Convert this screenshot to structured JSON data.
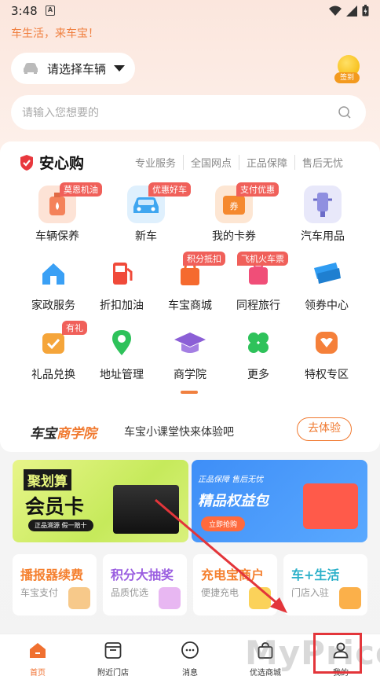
{
  "status_bar": {
    "time": "3:48",
    "app_badge": "A"
  },
  "header": {
    "slogan": "车生活，来车宝！",
    "car_selector": "请选择车辆",
    "signin_label": "签到",
    "search_placeholder": "请输入您想要的"
  },
  "anxin": {
    "brand": "安心购",
    "guarantees": [
      "专业服务",
      "全国网点",
      "正品保障",
      "售后无忧"
    ]
  },
  "services": [
    {
      "label": "车辆保养",
      "tag": "莫恩机油",
      "icon": "oil-bottle-icon",
      "color": "#f4825a"
    },
    {
      "label": "新车",
      "tag": "优惠好车",
      "icon": "car-icon",
      "color": "#3fa6f0"
    },
    {
      "label": "我的卡券",
      "tag": "支付优惠",
      "icon": "coupon-icon",
      "color": "#f5892f"
    },
    {
      "label": "汽车用品",
      "tag": "",
      "icon": "phone-holder-icon",
      "color": "#8f8fe0"
    },
    {
      "label": "家政服务",
      "tag": "",
      "icon": "house-cleaning-icon",
      "color": "#3aa0f5"
    },
    {
      "label": "折扣加油",
      "tag": "",
      "icon": "fuel-pump-icon",
      "color": "#f04a3a"
    },
    {
      "label": "车宝商城",
      "tag": "积分抵扣",
      "icon": "shopping-bag-icon",
      "color": "#f56a2f"
    },
    {
      "label": "同程旅行",
      "tag": "飞机火车票",
      "icon": "suitcase-icon",
      "color": "#f04e78"
    },
    {
      "label": "领券中心",
      "tag": "",
      "icon": "ticket-icon",
      "color": "#2f9cf2"
    },
    {
      "label": "礼品兑换",
      "tag": "有礼",
      "icon": "gift-calendar-icon",
      "color": "#f5a53a"
    },
    {
      "label": "地址管理",
      "tag": "",
      "icon": "location-pin-icon",
      "color": "#2ec25a"
    },
    {
      "label": "商学院",
      "tag": "",
      "icon": "graduation-cap-icon",
      "color": "#8b5fd6"
    },
    {
      "label": "更多",
      "tag": "",
      "icon": "clover-icon",
      "color": "#2ec25a"
    },
    {
      "label": "特权专区",
      "tag": "",
      "icon": "vip-shield-icon",
      "color": "#f5803a"
    }
  ],
  "academy": {
    "logo_prefix": "车宝",
    "logo_suffix": "商学院",
    "text": "车宝小课堂快来体验吧",
    "button": "去体验"
  },
  "banners": [
    {
      "title_top": "聚划算",
      "title_main": "会员卡",
      "subtitle": "正品溯源 假一赔十"
    },
    {
      "title_top": "正品保障 售后无忧",
      "title_main": "精品权益包",
      "button": "立即抢购"
    }
  ],
  "tiles": [
    {
      "title": "播报器续费",
      "subtitle": "车宝支付",
      "color": "#f5802f",
      "icon": "qr-device-icon"
    },
    {
      "title": "积分大抽奖",
      "subtitle": "品质优选",
      "color": "#9a5de0",
      "icon": "gift-box-icon"
    },
    {
      "title": "充电宝商户",
      "subtitle": "便捷充电",
      "color": "#f5802f",
      "icon": "lightning-icon"
    },
    {
      "title": "车+生活",
      "subtitle": "门店入驻",
      "color": "#2bb0c9",
      "icon": "store-icon"
    }
  ],
  "tabbar": [
    {
      "label": "首页",
      "icon": "home-icon",
      "active": true
    },
    {
      "label": "附近门店",
      "icon": "store-front-icon",
      "active": false
    },
    {
      "label": "消息",
      "icon": "chat-bubble-icon",
      "active": false
    },
    {
      "label": "优选商城",
      "icon": "shopping-bag-icon",
      "active": false
    },
    {
      "label": "我的",
      "icon": "user-profile-icon",
      "active": false
    }
  ],
  "watermark": "MyPrice",
  "annotation": {
    "highlight_color": "#e3353a"
  }
}
